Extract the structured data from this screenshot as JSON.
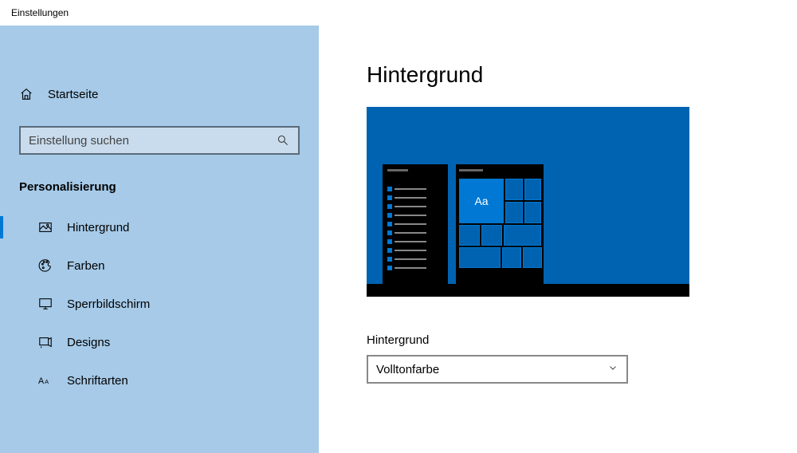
{
  "window": {
    "title": "Einstellungen"
  },
  "sidebar": {
    "home": "Startseite",
    "search_placeholder": "Einstellung suchen",
    "section": "Personalisierung",
    "items": [
      {
        "label": "Hintergrund"
      },
      {
        "label": "Farben"
      },
      {
        "label": "Sperrbildschirm"
      },
      {
        "label": "Designs"
      },
      {
        "label": "Schriftarten"
      }
    ]
  },
  "main": {
    "title": "Hintergrund",
    "preview_sample": "Aa",
    "background_label": "Hintergrund",
    "background_value": "Volltonfarbe"
  }
}
